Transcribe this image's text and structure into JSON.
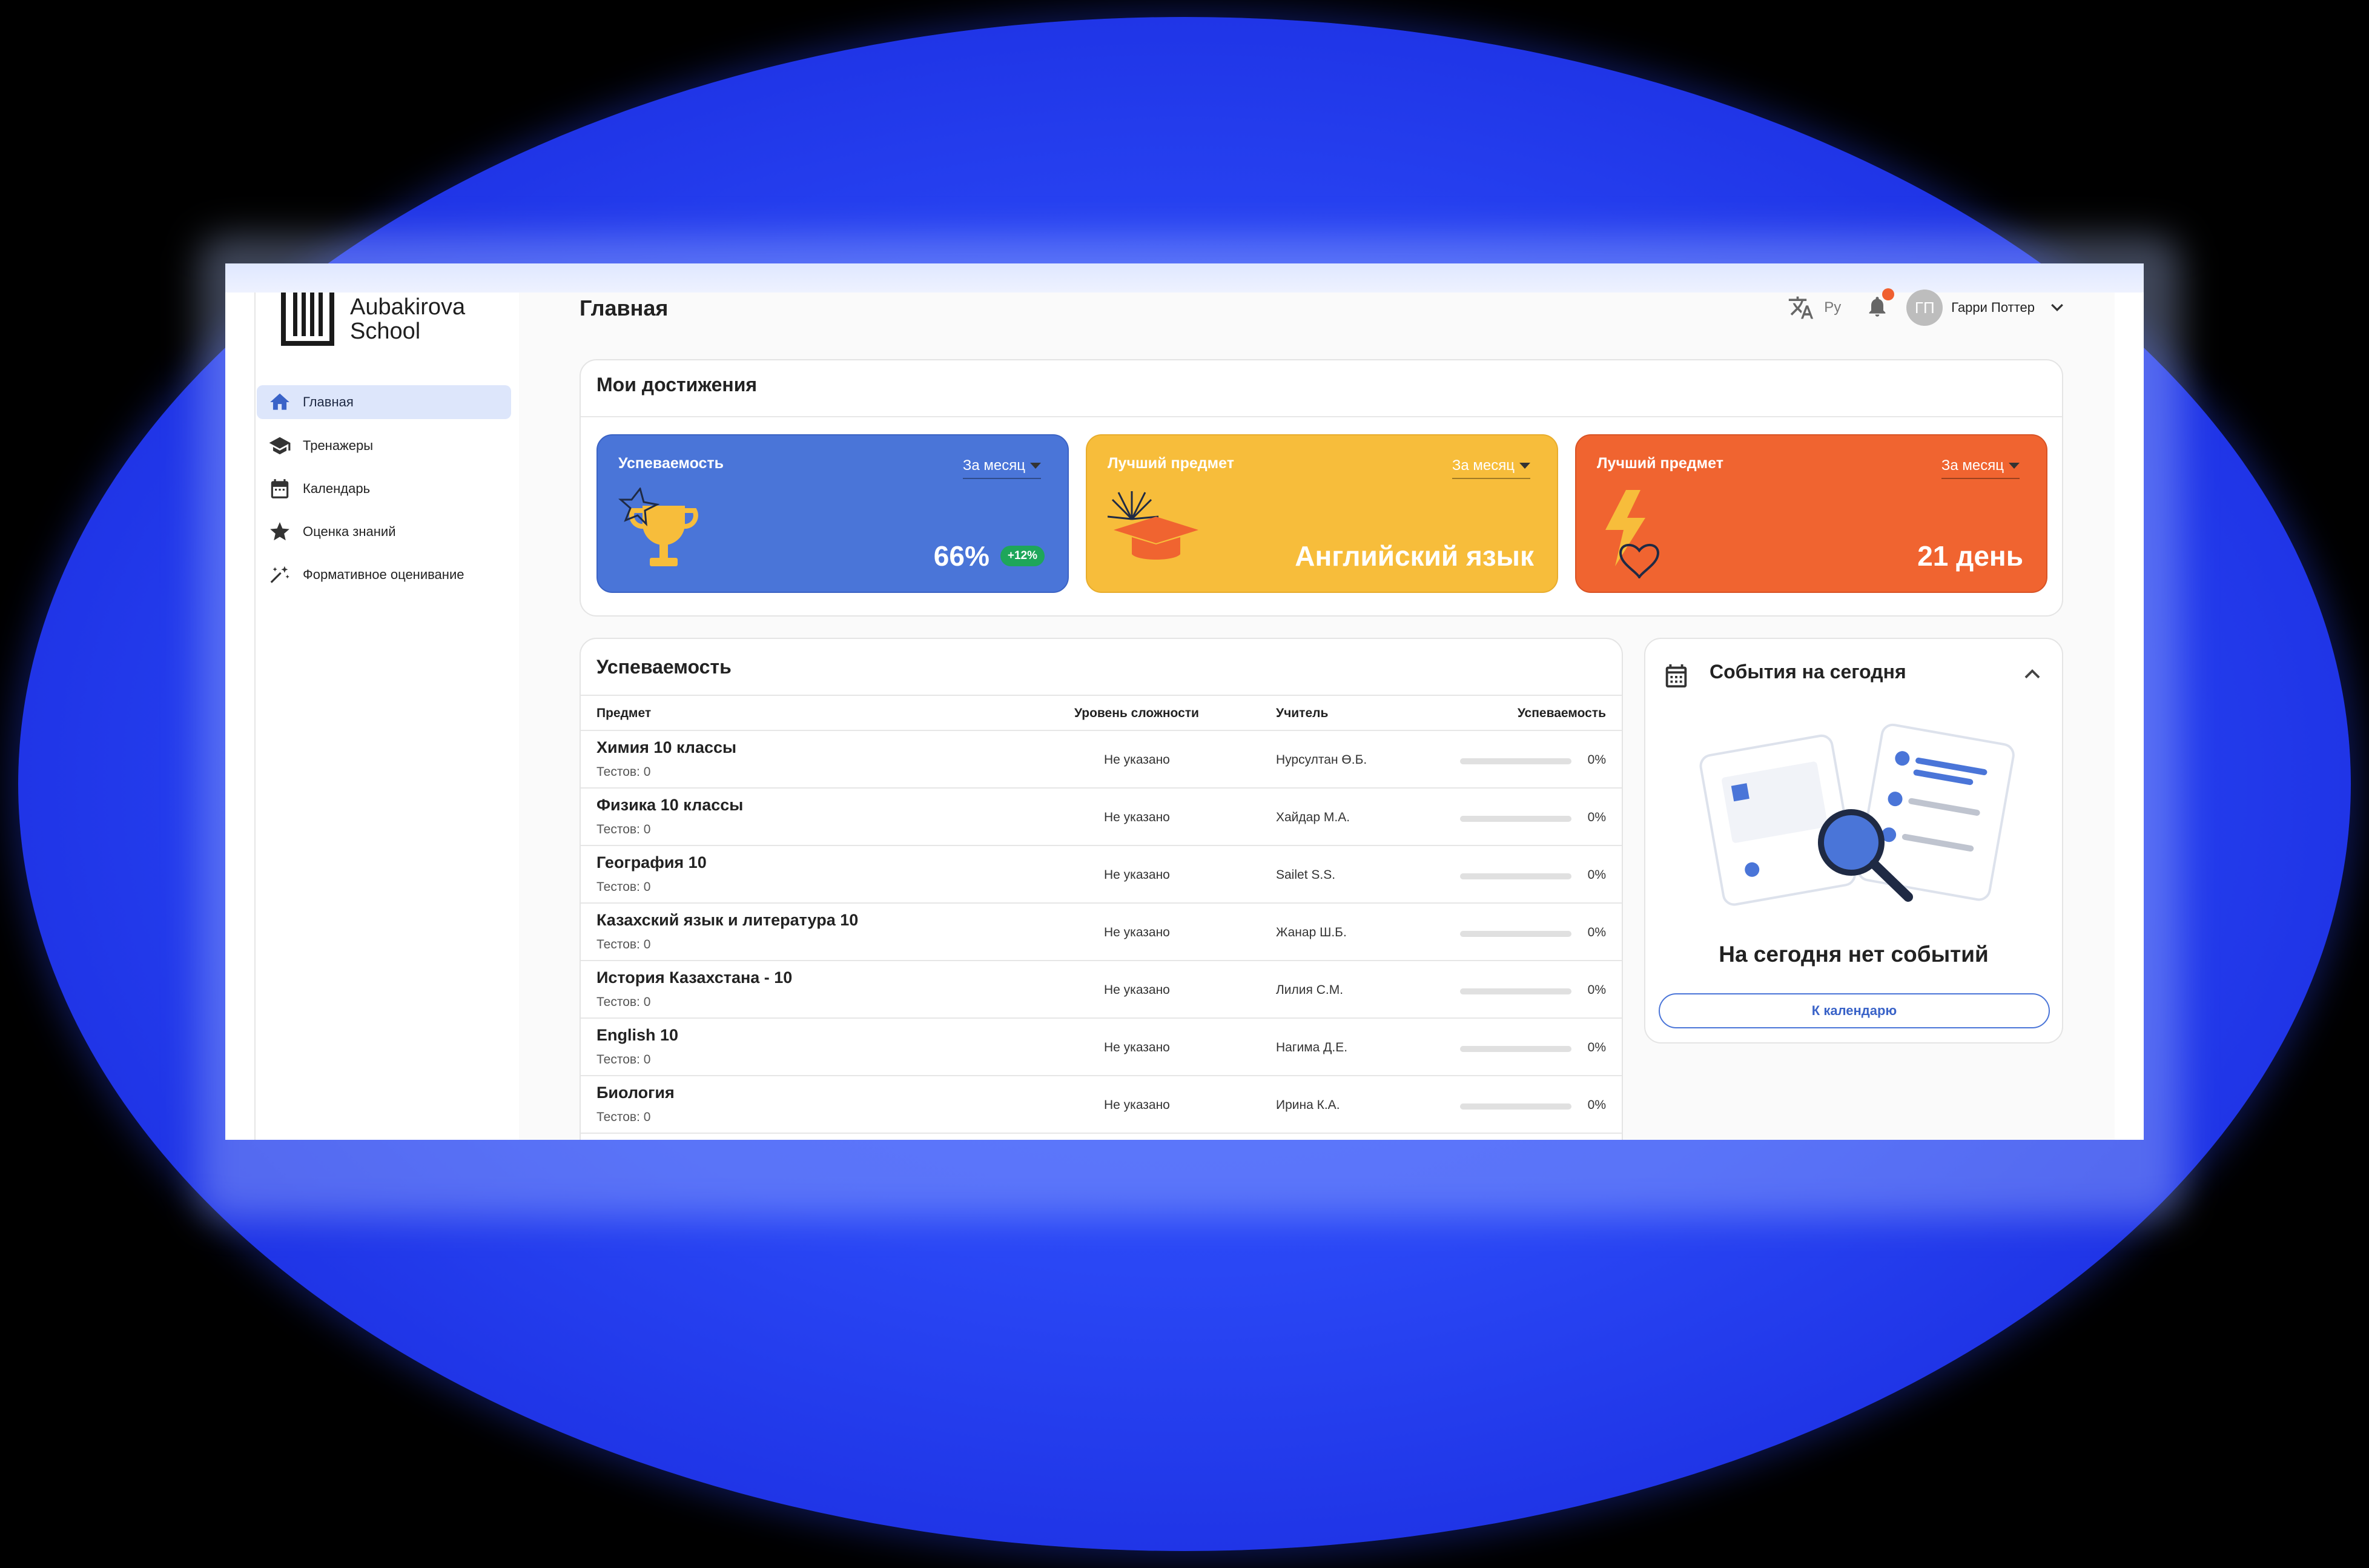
{
  "brand": {
    "logo_text_line1": "Aubakirova",
    "logo_text_line2": "School"
  },
  "sidebar": {
    "items": [
      {
        "label": "Главная",
        "icon": "home-icon",
        "active": true
      },
      {
        "label": "Тренажеры",
        "icon": "graduation-cap-icon",
        "active": false
      },
      {
        "label": "Календарь",
        "icon": "calendar-icon",
        "active": false
      },
      {
        "label": "Оценка знаний",
        "icon": "star-icon",
        "active": false
      },
      {
        "label": "Формативное оценивание",
        "icon": "sparkles-icon",
        "active": false
      }
    ]
  },
  "header": {
    "title": "Главная",
    "language": "Ру",
    "user_initials": "ГП",
    "user_name": "Гарри Поттер"
  },
  "achievements": {
    "title": "Мои достижения",
    "cards": [
      {
        "title": "Успеваемость",
        "period": "За месяц",
        "value": "66%",
        "delta": "+12%",
        "color": "#4a75d8",
        "icon": "trophy-icon"
      },
      {
        "title": "Лучший предмет",
        "period": "За месяц",
        "value": "Английский язык",
        "color": "#f7bd3b",
        "icon": "graduation-cap-icon"
      },
      {
        "title": "Лучший предмет",
        "period": "За месяц",
        "value": "21 день",
        "color": "#f06430",
        "icon": "lightning-heart-icon"
      }
    ]
  },
  "performance": {
    "title": "Успеваемость",
    "columns": [
      "Предмет",
      "Уровень сложности",
      "Учитель",
      "Успеваемость"
    ],
    "rows": [
      {
        "subject": "Химия 10 классы",
        "tests": "Тестов: 0",
        "level": "Не указано",
        "teacher": "Нурсултан Ө.Б.",
        "progress": 0,
        "percent": "0%"
      },
      {
        "subject": "Физика 10 классы",
        "tests": "Тестов: 0",
        "level": "Не указано",
        "teacher": "Хайдар М.А.",
        "progress": 0,
        "percent": "0%"
      },
      {
        "subject": "География 10",
        "tests": "Тестов: 0",
        "level": "Не указано",
        "teacher": "Sailet S.S.",
        "progress": 0,
        "percent": "0%"
      },
      {
        "subject": "Казахский язык и литература 10",
        "tests": "Тестов: 0",
        "level": "Не указано",
        "teacher": "Жанар Ш.Б.",
        "progress": 0,
        "percent": "0%"
      },
      {
        "subject": "История Казахстана - 10",
        "tests": "Тестов: 0",
        "level": "Не указано",
        "teacher": "Лилия С.М.",
        "progress": 0,
        "percent": "0%"
      },
      {
        "subject": "English 10",
        "tests": "Тестов: 0",
        "level": "Не указано",
        "teacher": "Нагима Д.Е.",
        "progress": 0,
        "percent": "0%"
      },
      {
        "subject": "Биология",
        "tests": "Тестов: 0",
        "level": "Не указано",
        "teacher": "Ирина К.А.",
        "progress": 0,
        "percent": "0%"
      }
    ]
  },
  "events": {
    "title": "События на сегодня",
    "empty_text": "На сегодня нет событий",
    "button_label": "К календарю"
  },
  "colors": {
    "accent": "#4a75d8",
    "backdrop": "#2a47f5",
    "notification": "#f06030",
    "success": "#1ea65a"
  }
}
